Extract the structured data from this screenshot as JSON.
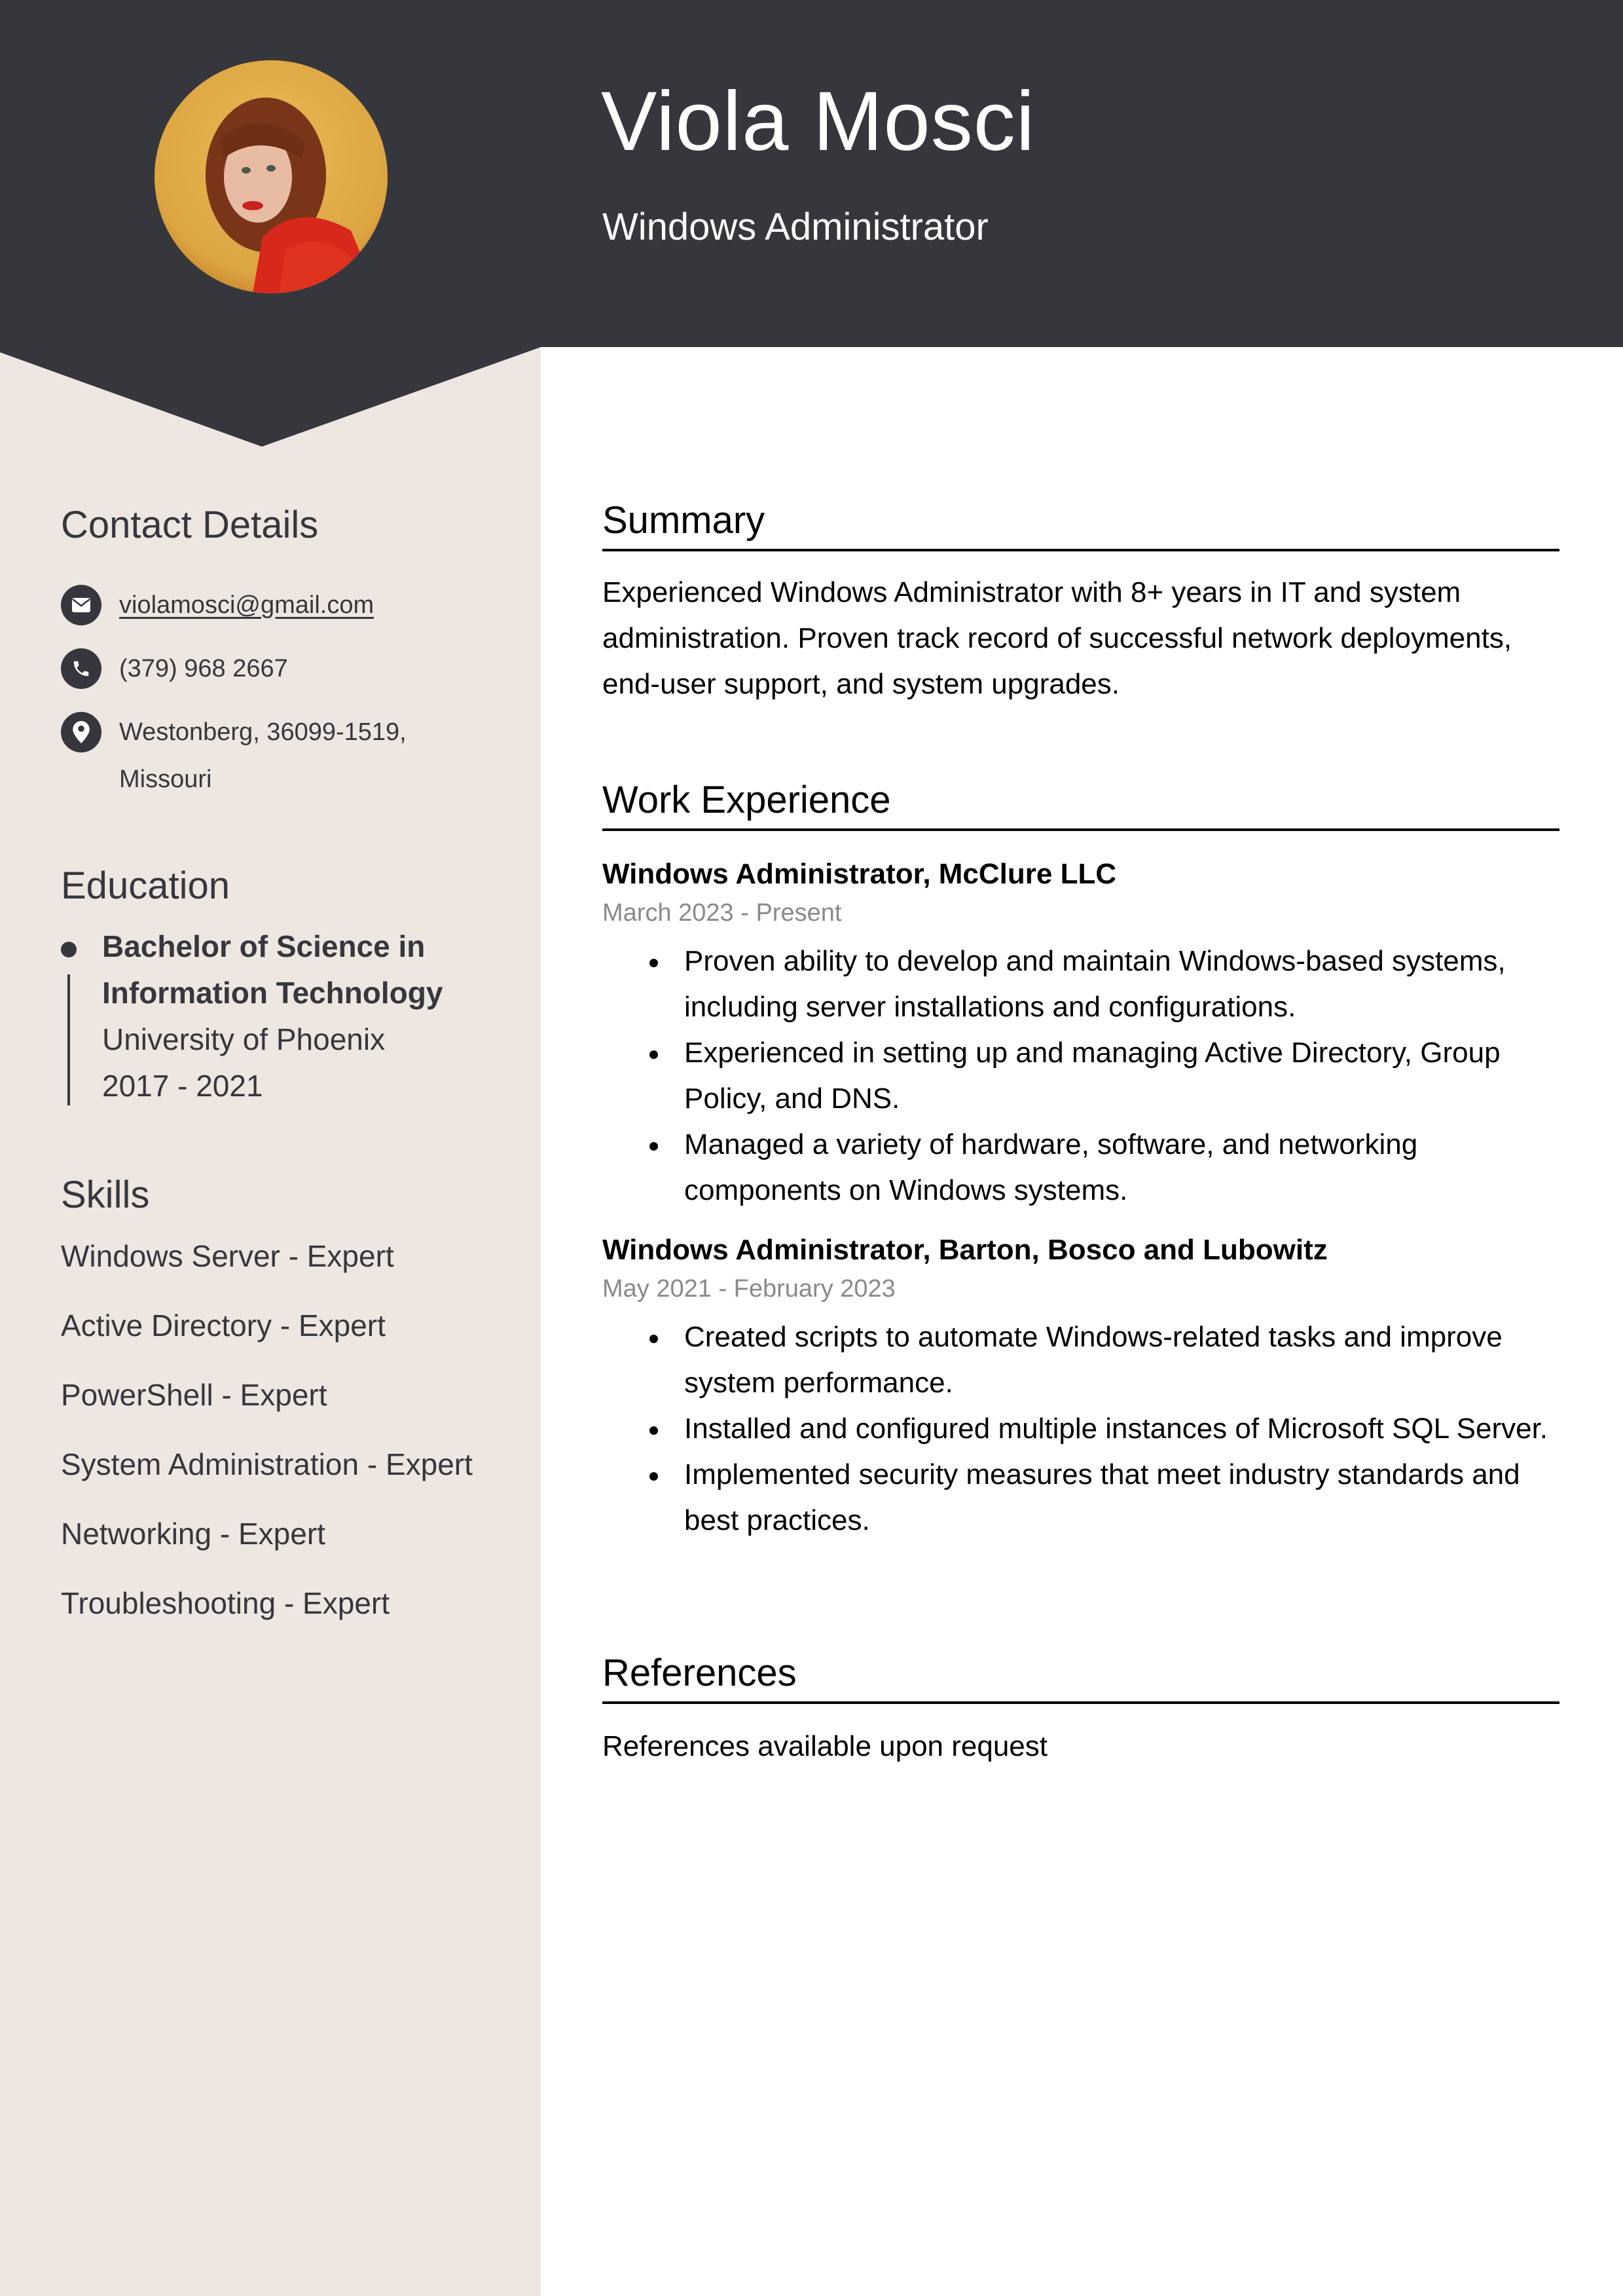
{
  "header": {
    "name": "Viola Mosci",
    "title": "Windows Administrator",
    "photo_icon": "profile-photo"
  },
  "colors": {
    "header_bg": "#36373d",
    "sidebar_bg": "#ede6e1",
    "accent_text": "#36373d",
    "date_text": "#8a8a8a"
  },
  "sidebar": {
    "contact": {
      "heading": "Contact Details",
      "items": [
        {
          "icon": "email-icon",
          "text": "violamosci@gmail.com"
        },
        {
          "icon": "phone-icon",
          "text": "(379) 968 2667"
        },
        {
          "icon": "location-icon",
          "text": "Westonberg, 36099-1519,",
          "text2": "Missouri"
        }
      ]
    },
    "education": {
      "heading": "Education",
      "degree_line1": "Bachelor of Science in",
      "degree_line2": "Information Technology",
      "school": "University of Phoenix",
      "years": "2017 - 2021"
    },
    "skills": {
      "heading": "Skills",
      "items": [
        "Windows Server - Expert",
        "Active Directory - Expert",
        "PowerShell - Expert",
        "System Administration - Expert",
        "Networking - Expert",
        "Troubleshooting - Expert"
      ]
    }
  },
  "main": {
    "summary": {
      "heading": "Summary",
      "text": "Experienced Windows Administrator with 8+ years in IT and system administration. Proven track record of successful network deployments, end-user support, and system upgrades."
    },
    "experience": {
      "heading": "Work Experience",
      "jobs": [
        {
          "title": "Windows Administrator, McClure LLC",
          "dates": "March 2023 - Present",
          "bullets": [
            "Proven ability to develop and maintain Windows-based systems, including server installations and configurations.",
            "Experienced in setting up and managing Active Directory, Group Policy, and DNS.",
            "Managed a variety of hardware, software, and networking components on Windows systems."
          ]
        },
        {
          "title": "Windows Administrator, Barton, Bosco and Lubowitz",
          "dates": "May 2021 - February 2023",
          "bullets": [
            "Created scripts to automate Windows-related tasks and improve system performance.",
            "Installed and configured multiple instances of Microsoft SQL Server.",
            "Implemented security measures that meet industry standards and best practices."
          ]
        }
      ]
    },
    "references": {
      "heading": "References",
      "text": "References available upon request"
    }
  }
}
